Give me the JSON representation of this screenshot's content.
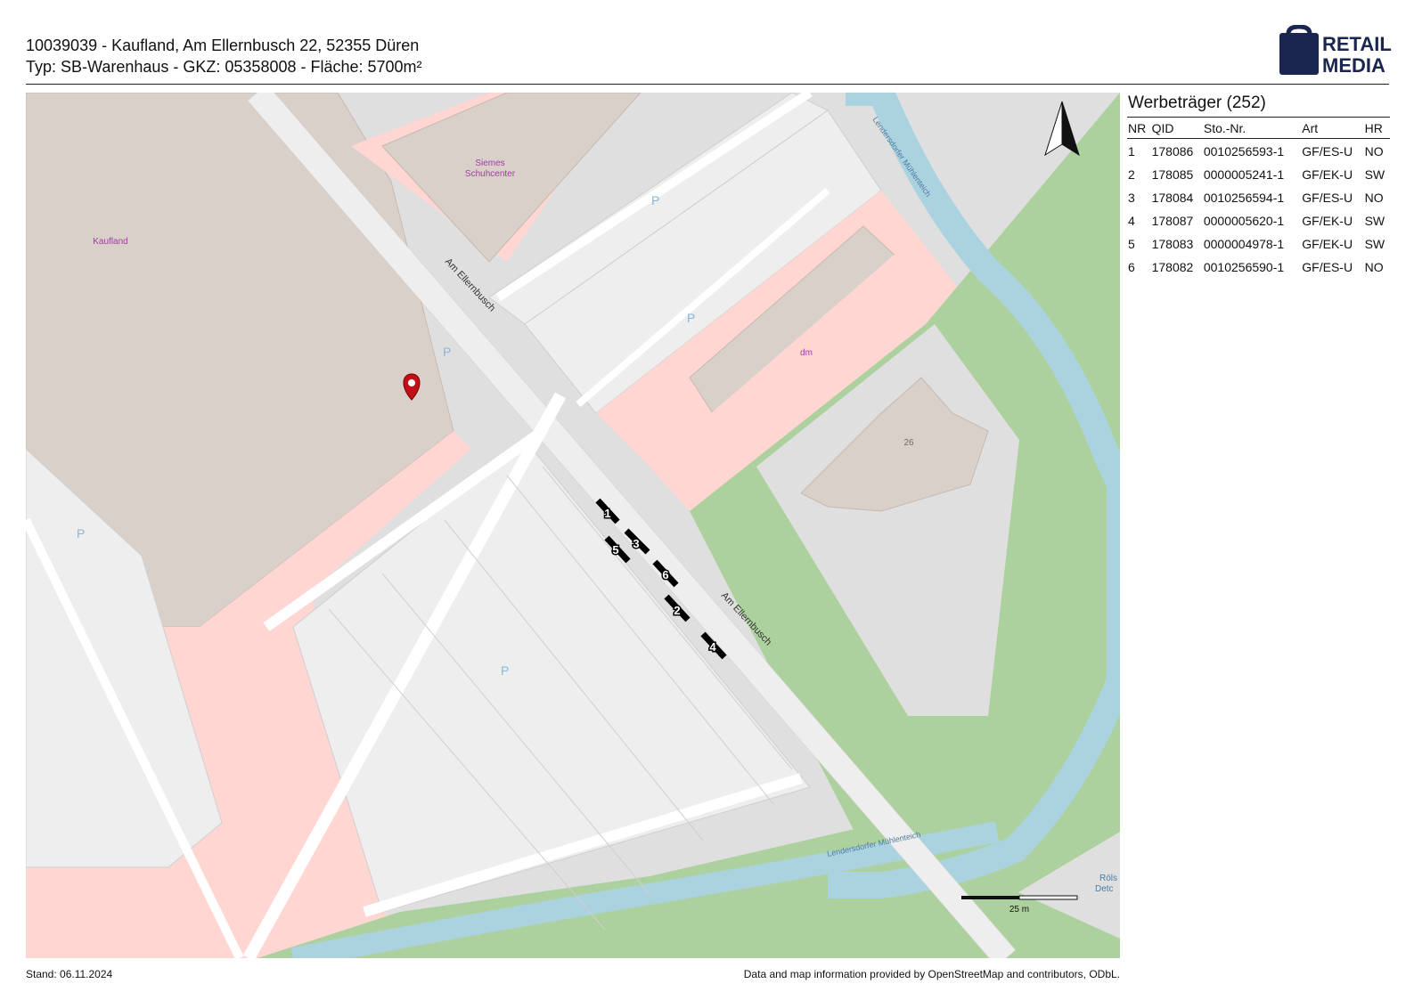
{
  "header": {
    "title": "10039039 - Kaufland, Am Ellernbusch 22, 52355 Düren",
    "subtitle": "Typ: SB-Warenhaus - GKZ: 05358008 - Fläche: 5700m²"
  },
  "logo": {
    "line1": "RETAIL",
    "line2": "MEDIA",
    "icon": "shopping-bag-icon",
    "color": "#1b2650"
  },
  "map": {
    "labels": {
      "kaufland": "Kaufland",
      "siemes_line1": "Siemes",
      "siemes_line2": "Schuhcenter",
      "dm": "dm",
      "street_top": "Am Ellernbusch",
      "street_bottom": "Am Ellernbusch",
      "stream_top": "Lendersdorfer Mühlenteich",
      "stream_bottom": "Lendersdorfer Mühlenteich",
      "house_number": "26",
      "parking": "P",
      "cut_line1": "Röls",
      "cut_line2": "Detc"
    },
    "scale_label": "25 m",
    "north_arrow": "north-arrow-icon",
    "location_pin": "location-pin-icon",
    "markers": [
      "1",
      "2",
      "3",
      "4",
      "5",
      "6"
    ],
    "colors": {
      "background": "#e0dfdf",
      "building": "#d9d0c9",
      "retail": "#ffd6d1",
      "parking": "#eeeeee",
      "grass": "#add19e",
      "water": "#aad3df",
      "road": "#ffffff",
      "poi_text": "#a23ca5",
      "parking_text": "#8ab6d8"
    }
  },
  "legend": {
    "title": "Werbeträger (252)",
    "columns": [
      "NR",
      "QID",
      "Sto.-Nr.",
      "Art",
      "HR"
    ],
    "rows": [
      [
        "1",
        "178086",
        "0010256593-1",
        "GF/ES-U",
        "NO"
      ],
      [
        "2",
        "178085",
        "0000005241-1",
        "GF/EK-U",
        "SW"
      ],
      [
        "3",
        "178084",
        "0010256594-1",
        "GF/ES-U",
        "NO"
      ],
      [
        "4",
        "178087",
        "0000005620-1",
        "GF/EK-U",
        "SW"
      ],
      [
        "5",
        "178083",
        "0000004978-1",
        "GF/EK-U",
        "SW"
      ],
      [
        "6",
        "178082",
        "0010256590-1",
        "GF/ES-U",
        "NO"
      ]
    ]
  },
  "footer": {
    "date": "Stand: 06.11.2024",
    "attribution": "Data and map information provided by OpenStreetMap and contributors, ODbL."
  }
}
